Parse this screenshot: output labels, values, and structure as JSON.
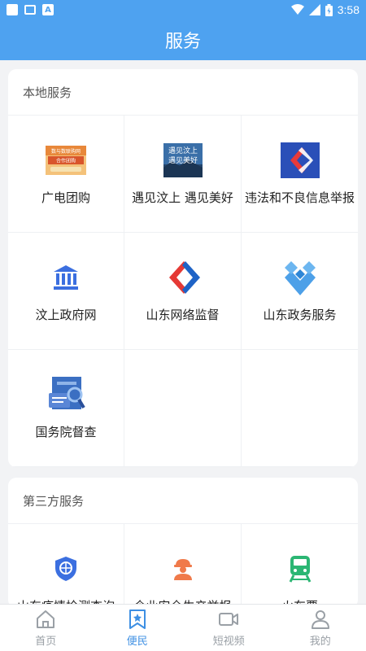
{
  "status_bar": {
    "time": "3:58"
  },
  "header": {
    "title": "服务"
  },
  "local_services": {
    "title": "本地服务",
    "items": [
      {
        "label": "广电团购",
        "icon": "group-buy-banner-icon",
        "icon_text": [
          "数与数联购网",
          "合作团购"
        ]
      },
      {
        "label": "遇见汶上 遇见美好",
        "icon": "wenshang-banner-icon",
        "icon_text": [
          "遇见汶上",
          "遇见美好"
        ]
      },
      {
        "label": "违法和不良信息举报",
        "icon": "report-icon"
      },
      {
        "label": "汶上政府网",
        "icon": "government-building-icon"
      },
      {
        "label": "山东网络监督",
        "icon": "shandong-network-icon"
      },
      {
        "label": "山东政务服务",
        "icon": "shandong-gov-service-icon"
      },
      {
        "label": "国务院督查",
        "icon": "state-council-inspection-icon"
      }
    ]
  },
  "third_party_services": {
    "title": "第三方服务",
    "items": [
      {
        "label": "山东疫情检测查询",
        "icon": "shield-check-icon"
      },
      {
        "label": "企业安全生产举报",
        "icon": "worker-helmet-icon"
      },
      {
        "label": "火车票",
        "icon": "train-icon"
      }
    ]
  },
  "bottom_nav": [
    {
      "label": "首页",
      "icon": "home-icon",
      "active": false
    },
    {
      "label": "便民",
      "icon": "bookmark-star-icon",
      "active": true
    },
    {
      "label": "短视频",
      "icon": "video-camera-icon",
      "active": false
    },
    {
      "label": "我的",
      "icon": "user-icon",
      "active": false
    }
  ],
  "colors": {
    "primary": "#4ea2f0",
    "active_nav": "#3d8fe3",
    "inactive_nav": "#9aa0a6",
    "background": "#f2f3f5"
  }
}
